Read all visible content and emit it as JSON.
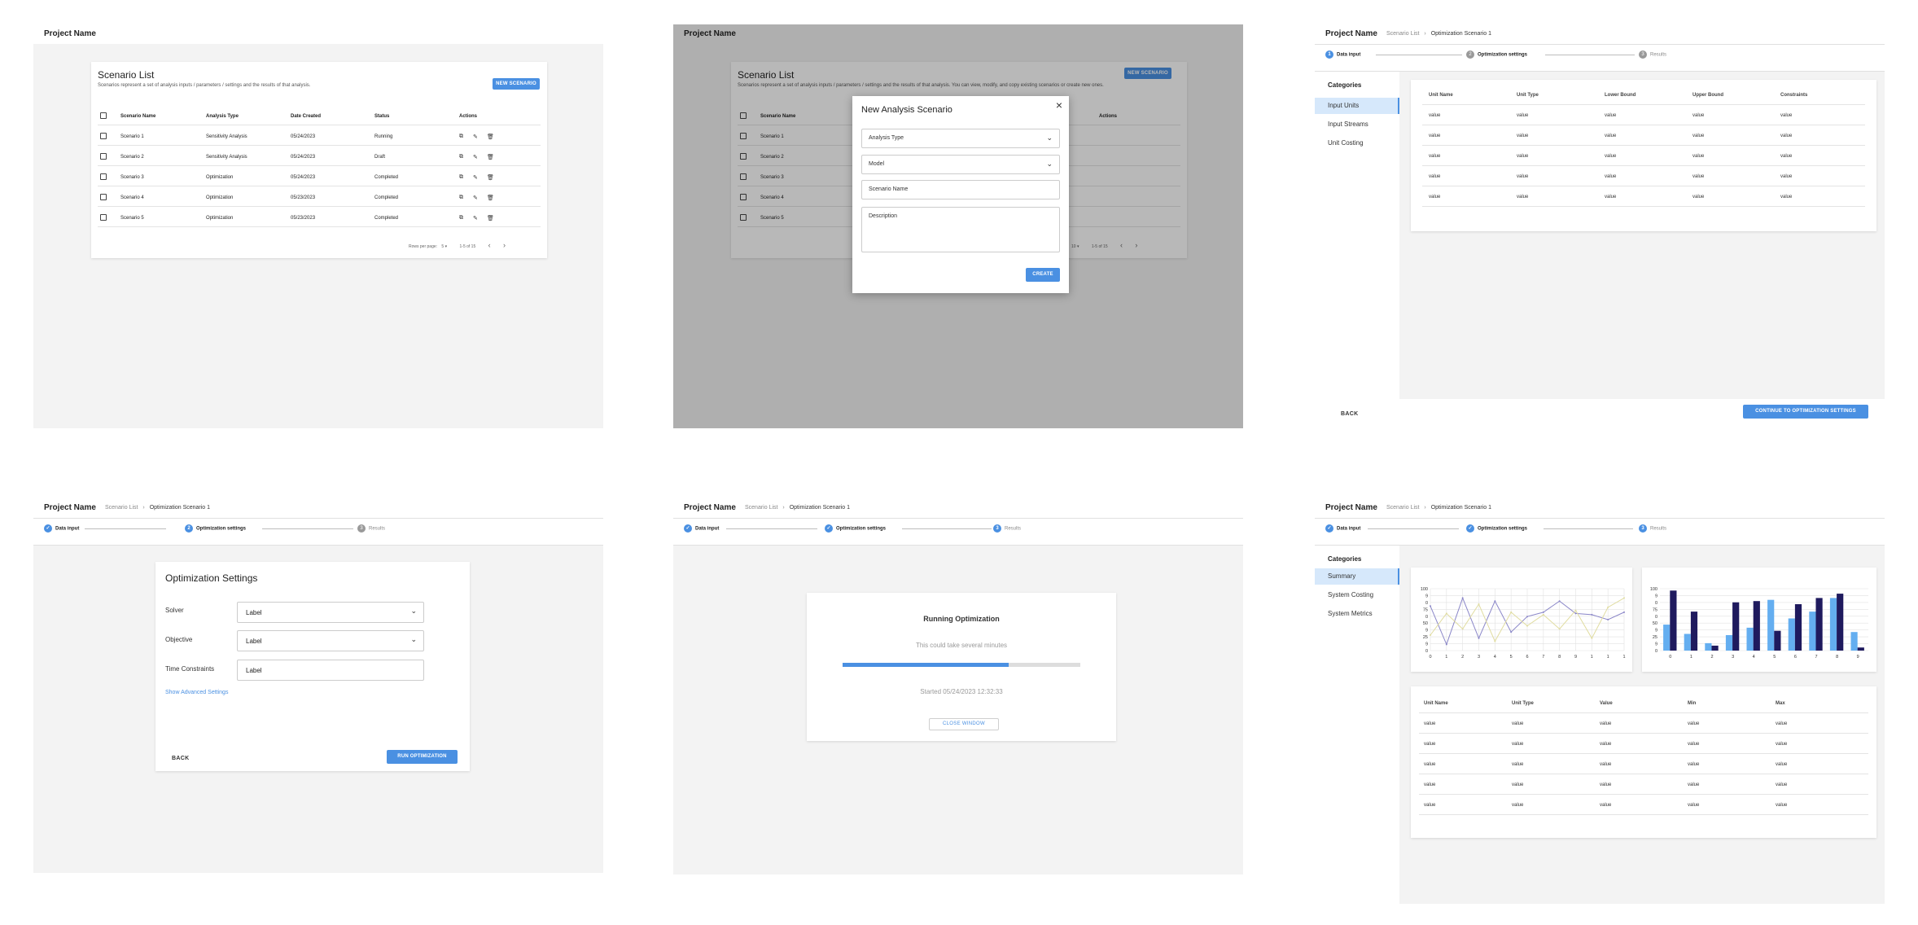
{
  "project_name": "Project Name",
  "list": {
    "title": "Scenario List",
    "subtitle": "Scenarios represent a set of analysis inputs / parameters / settings and the results of that analysis.",
    "subtitle_dimmed": "Scenarios represent a set of analysis inputs / parameters / settings and the results of that analysis. You can view, modify, and copy existing scenarios or create new ones.",
    "new_button": "NEW SCENARIO",
    "columns": [
      "Scenario Name",
      "Analysis Type",
      "Date Created",
      "Status",
      "Actions"
    ],
    "rows": [
      {
        "name": "Scenario 1",
        "type": "Sensitivity Analysis",
        "date": "05/24/2023",
        "status": "Running"
      },
      {
        "name": "Scenario 2",
        "type": "Sensitivity Analysis",
        "date": "05/24/2023",
        "status": "Draft"
      },
      {
        "name": "Scenario 3",
        "type": "Optimization",
        "date": "05/24/2023",
        "status": "Completed"
      },
      {
        "name": "Scenario 4",
        "type": "Optimization",
        "date": "05/23/2023",
        "status": "Completed"
      },
      {
        "name": "Scenario 5",
        "type": "Optimization",
        "date": "05/23/2023",
        "status": "Completed"
      }
    ],
    "rows_per_page_label": "Rows per page:",
    "rows_per_page": "5",
    "rows_per_page_dimmed": "10",
    "page_range": "1-5 of 15",
    "page_range_dimmed": "1-5 of 15"
  },
  "dialog": {
    "title": "New Analysis Scenario",
    "close": "×",
    "analysis_type": "Analysis Type",
    "model": "Model",
    "scenario_name": "Scenario Name",
    "description": "Description",
    "create": "CREATE"
  },
  "breadcrumb": {
    "root": "Scenario List",
    "sep": "›",
    "current": "Optimization Scenario 1"
  },
  "steps": [
    "Data input",
    "Optimization settings",
    "Results"
  ],
  "step_numbers": [
    "1",
    "2",
    "3"
  ],
  "step_check": "✓",
  "input": {
    "categories_title": "Categories",
    "categories": [
      "Input Units",
      "Input Streams",
      "Unit Costing"
    ],
    "columns": [
      "Unit Name",
      "Unit Type",
      "Lower Bound",
      "Upper Bound",
      "Constraints"
    ],
    "cell": "value",
    "back": "BACK",
    "continue": "CONTINUE TO OPTIMIZATION SETTINGS"
  },
  "settings": {
    "title": "Optimization Settings",
    "solver_label": "Solver",
    "solver_value": "Label",
    "objective_label": "Objective",
    "objective_value": "Label",
    "time_label": "Time Constraints",
    "time_value": "Label",
    "advanced": "Show Advanced Settings",
    "back": "BACK",
    "run": "RUN OPTIMIZATION"
  },
  "running": {
    "title": "Running Optimization",
    "note": "This could take several minutes",
    "progress": 0.7,
    "started": "Started 05/24/2023 12:32:33",
    "close": "CLOSE WINDOW"
  },
  "results": {
    "categories_title": "Categories",
    "categories": [
      "Summary",
      "System Costing",
      "System Metrics"
    ],
    "columns": [
      "Unit Name",
      "Unit Type",
      "Value",
      "Min",
      "Max"
    ],
    "cell": "value"
  },
  "colors": {
    "accent": "#4a90e2",
    "navy": "#1f1a5e",
    "light_blue": "#64aef0",
    "line_purple": "#8a86c8",
    "line_yellow": "#e0dca0"
  },
  "chart_data": [
    {
      "type": "line",
      "x": [
        "0",
        "1",
        "2",
        "3",
        "4",
        "5",
        "6",
        "7",
        "8",
        "9",
        "1",
        "1",
        "1"
      ],
      "ytick_labels": [
        "100",
        "9",
        "0",
        "75",
        "0",
        "50",
        "9",
        "25",
        "9",
        "0"
      ],
      "ylim": [
        0,
        100
      ],
      "series": [
        {
          "values": [
            72,
            10,
            85,
            20,
            80,
            30,
            55,
            62,
            80,
            60,
            58,
            50,
            62
          ]
        },
        {
          "values": [
            25,
            60,
            35,
            75,
            15,
            62,
            40,
            58,
            35,
            65,
            20,
            70,
            85
          ]
        }
      ]
    },
    {
      "type": "bar",
      "categories": [
        "0",
        "1",
        "2",
        "3",
        "4",
        "5",
        "6",
        "7",
        "8",
        "9"
      ],
      "ytick_labels": [
        "100",
        "9",
        "0",
        "75",
        "0",
        "50",
        "9",
        "25",
        "9",
        "0"
      ],
      "ylim": [
        0,
        100
      ],
      "series": [
        {
          "values": [
            42,
            27,
            12,
            25,
            37,
            82,
            52,
            63,
            85,
            30
          ]
        },
        {
          "values": [
            97,
            63,
            8,
            78,
            80,
            32,
            75,
            85,
            92,
            5
          ]
        }
      ]
    }
  ]
}
